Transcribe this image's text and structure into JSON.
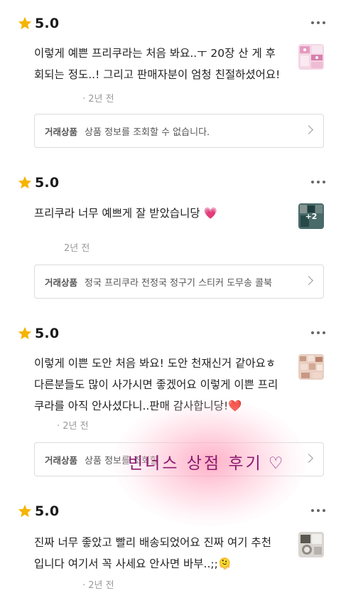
{
  "reviews": [
    {
      "score": "5.0",
      "lines": [
        "이렇게 예쁜 프리쿠라는 처음 봐요..ㅜ 20장 산 게 후",
        "회되는 정도..! 그리고 판매자분이 엄청 친절하셨어요!"
      ],
      "date": "· 2년 전",
      "thumb_badge": "",
      "product_tag": "거래상품",
      "product_name": "상품 정보를 조회할 수 없습니다."
    },
    {
      "score": "5.0",
      "lines": [
        "프리쿠라 너무 예쁘게 잘 받았습니당 💗"
      ],
      "date": "2년 전",
      "thumb_badge": "+2",
      "product_tag": "거래상품",
      "product_name": "정국 프리쿠라 전정국 정구기 스티커 도무송 콜북"
    },
    {
      "score": "5.0",
      "lines": [
        "이렇게 이쁜 도안 처음 봐요! 도안 천재신거 같아요ㅎ",
        "다른분들도 많이 사가시면 좋겠어요 이렇게 이쁜 프리",
        "쿠라를 아직 안사셨다니..판매 감사합니당!❤️"
      ],
      "date": "· 2년 전",
      "thumb_badge": "",
      "product_tag": "거래상품",
      "product_name": "상품 정보를 조회할"
    },
    {
      "score": "5.0",
      "lines": [
        "진짜 너무 좋았고 빨리 배송되었어요 진짜 여기 추천",
        "입니다 여기서 꼭 사세요 안사면 바부..;;🫠"
      ],
      "date": "· 2년 전",
      "thumb_badge": "",
      "product_tag": "",
      "product_name": ""
    }
  ],
  "overlay": {
    "text": "빈너스 상점 후기",
    "heart": "♡"
  },
  "icons": {
    "star": "star-icon",
    "more": "more-icon",
    "chevron": "chevron-right-icon"
  },
  "colors": {
    "star": "#F5B400",
    "overlay_text": "#8A1A70",
    "date": "#9A9A9A"
  }
}
